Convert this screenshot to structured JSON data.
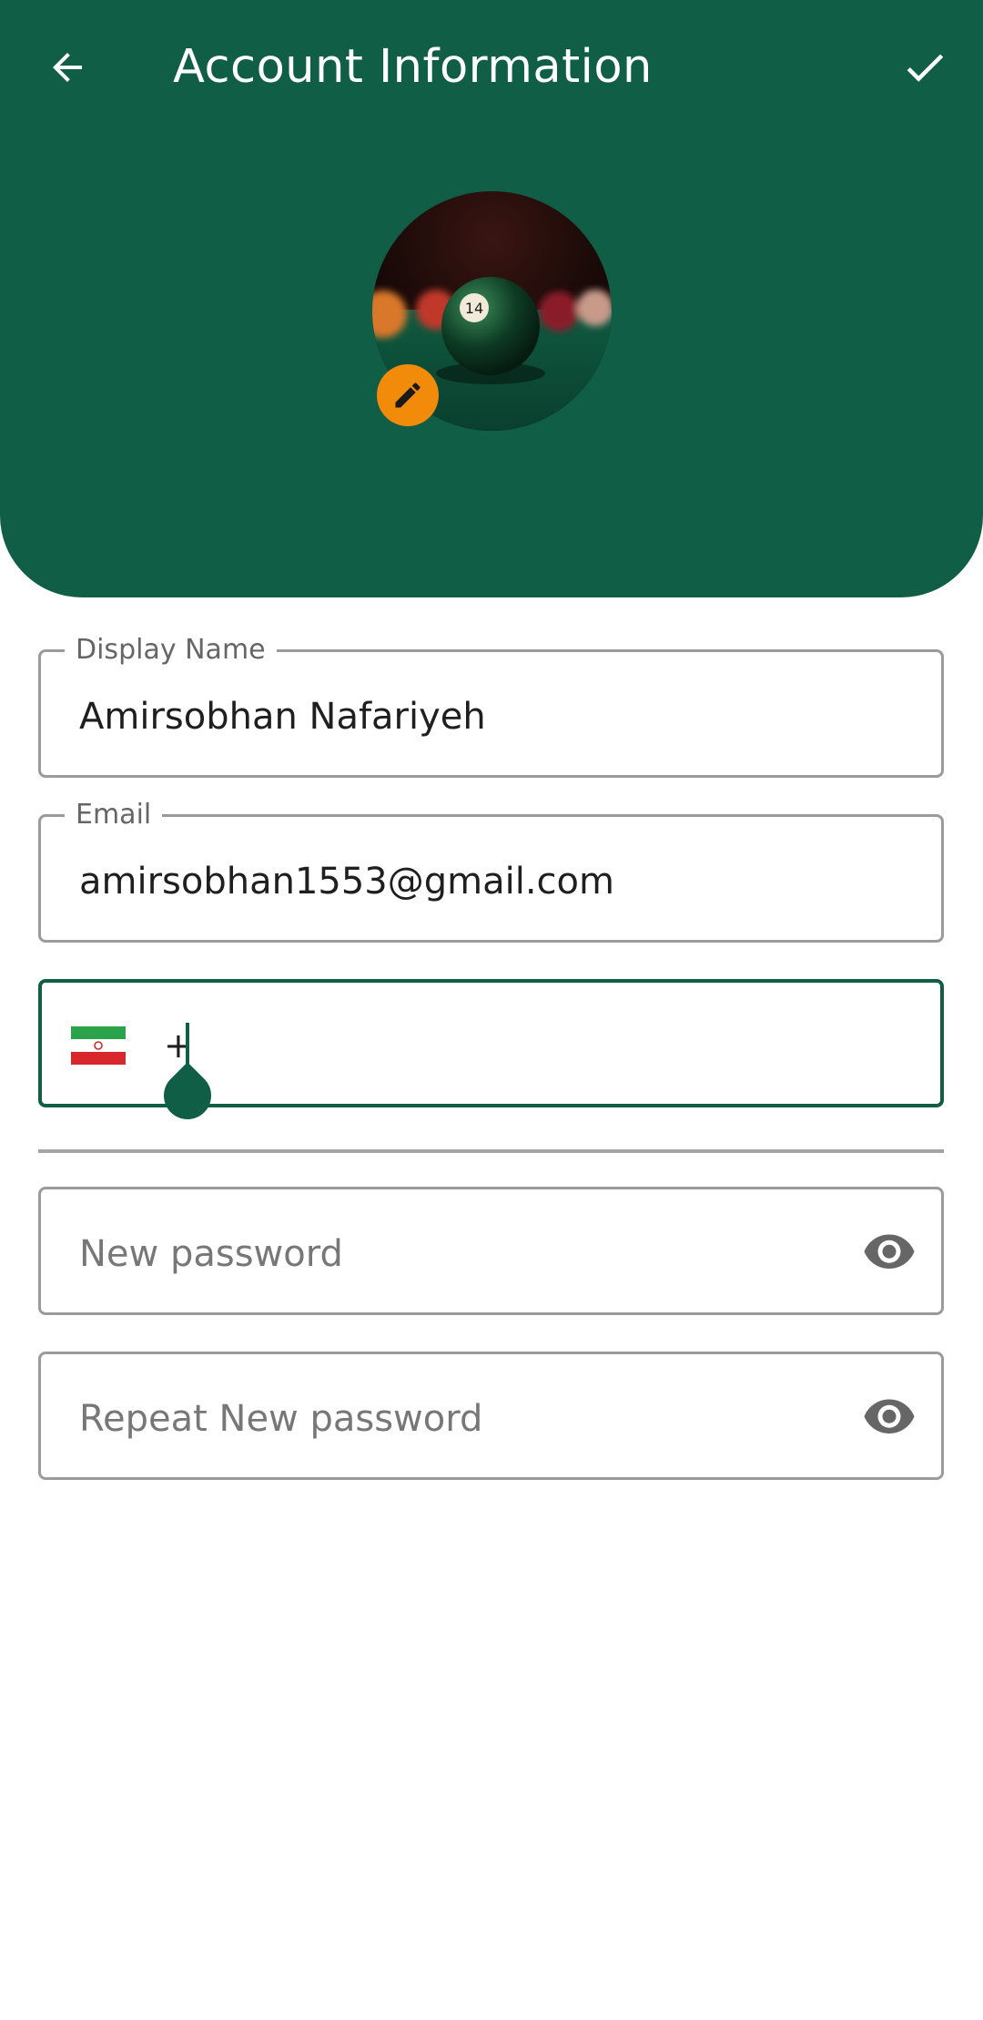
{
  "app_bar": {
    "title": "Account Information",
    "back_icon": "arrow-back-icon",
    "confirm_icon": "checkmark-icon"
  },
  "profile": {
    "avatar_alt": "billiard-ball-photo",
    "edit_icon": "pencil-icon"
  },
  "form": {
    "display_name": {
      "label": "Display Name",
      "value": "Amirsobhan Nafariyeh"
    },
    "email": {
      "label": "Email",
      "value": "amirsobhan1553@gmail.com"
    },
    "phone": {
      "prefix": "+",
      "flag_icon": "iran-flag-icon",
      "value": ""
    },
    "new_password": {
      "placeholder": "New password",
      "icon": "eye-icon"
    },
    "repeat_password": {
      "placeholder": "Repeat New password",
      "icon": "eye-icon"
    }
  },
  "colors": {
    "primary": "#0f5e45",
    "accent": "#f28a0a",
    "border": "#9b9b9b"
  }
}
